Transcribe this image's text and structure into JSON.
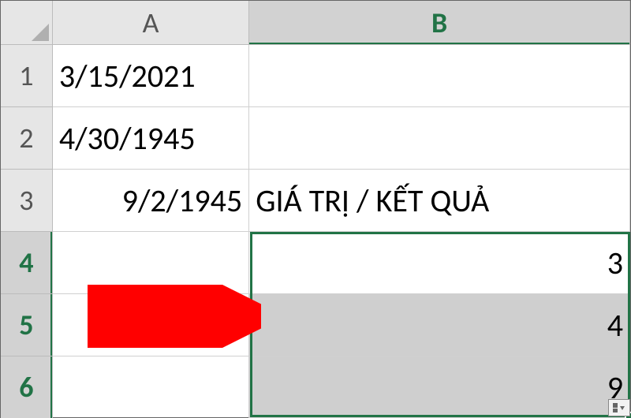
{
  "columns": {
    "A": "A",
    "B": "B"
  },
  "rows": {
    "1": {
      "label": "1",
      "A": "3/15/2021",
      "B": ""
    },
    "2": {
      "label": "2",
      "A": "4/30/1945",
      "B": ""
    },
    "3": {
      "label": "3",
      "A": "9/2/1945",
      "B": "GIÁ TRỊ / KẾT QUẢ"
    },
    "4": {
      "label": "4",
      "A": "",
      "B": "3"
    },
    "5": {
      "label": "5",
      "A": "",
      "B": "4"
    },
    "6": {
      "label": "6",
      "A": "",
      "B": "9"
    }
  },
  "selection": {
    "range": "B4:B6",
    "active_cell": "B4"
  },
  "annotation": {
    "type": "arrow",
    "color": "#ff0000"
  },
  "icons": {
    "autofill_options": "autofill-options-icon"
  }
}
